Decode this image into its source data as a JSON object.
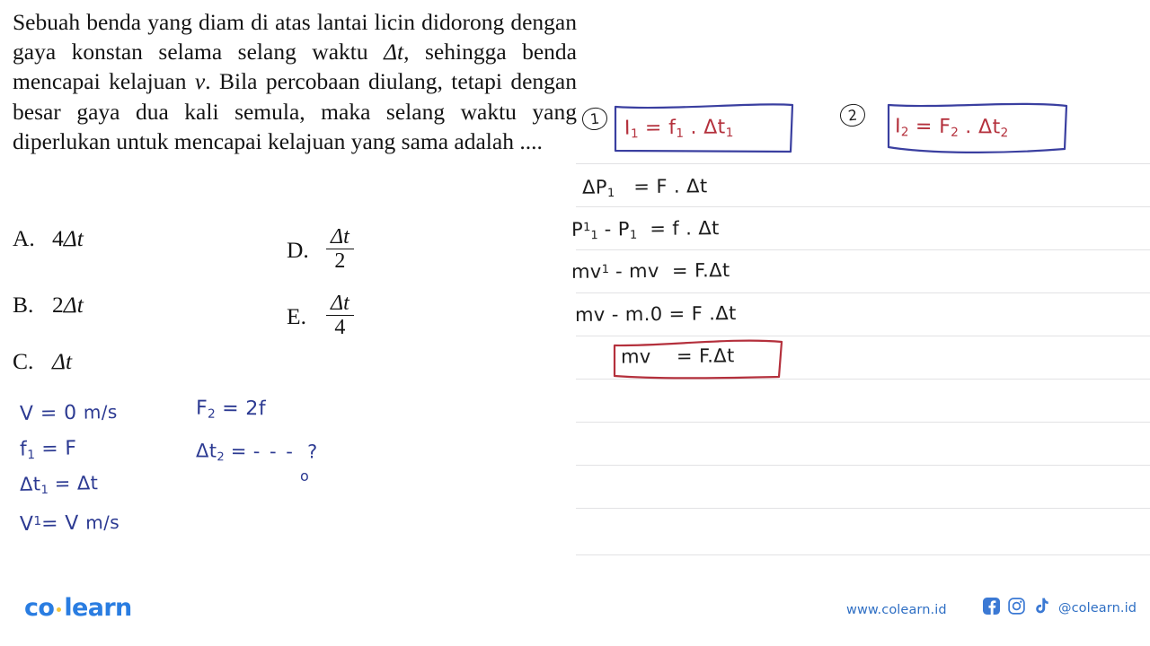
{
  "question": {
    "text_html": "Sebuah benda yang diam di atas lantai licin didorong dengan gaya konstan selama selang waktu <i>&#916;t</i>, sehingga benda mencapai kelajuan <i>v</i>. Bila percobaan diulang, tetapi dengan besar gaya dua kali semula, maka selang waktu yang diperlukan untuk mencapai kelajuan yang sama adalah ...."
  },
  "options": [
    {
      "letter": "A.",
      "value": "4Δt"
    },
    {
      "letter": "B.",
      "value": "2Δt"
    },
    {
      "letter": "C.",
      "value": "Δt"
    },
    {
      "letter": "D.",
      "value": "Δt / 2",
      "numerator": "Δt",
      "denominator": "2"
    },
    {
      "letter": "E.",
      "value": "Δt / 4",
      "numerator": "Δt",
      "denominator": "4"
    }
  ],
  "handwriting": {
    "left_notes": [
      "V = 0 m/s",
      "f₁ = F",
      "Δt₁ = Δt",
      "V' = V m/s"
    ],
    "mid_notes": [
      "F₂ = 2f",
      "Δt₂ = --- ?"
    ],
    "step_markers": [
      "1",
      "2"
    ],
    "boxed_formula_1": "I₁ = f₁ . Δt₁",
    "boxed_formula_2": "I₂ = F₂ . Δt₂",
    "derivation": [
      "ΔP₁   = F . Δt",
      "P'₁ - P₁  = f . Δt",
      "mv' - mv  = F.Δt",
      "mv - m.0 = F .Δt"
    ],
    "boxed_result": "mv    = F.Δt"
  },
  "ruled_lines": {
    "y_positions": [
      182,
      230,
      278,
      326,
      374,
      422,
      470,
      518,
      566,
      618
    ],
    "color": "#e2e2e4"
  },
  "footer": {
    "logo_first": "co",
    "logo_second": "learn",
    "website": "www.colearn.id",
    "handle": "@colearn.id",
    "icons": [
      "facebook-icon",
      "instagram-icon",
      "tiktok-icon"
    ]
  },
  "colors": {
    "ink_blue": "#2c3a92",
    "ink_red": "#b4303c",
    "ink_black": "#1b1b1b",
    "brand_blue": "#2a7de1",
    "brand_yellow": "#f5c53b",
    "link_blue": "#2f6fc4"
  }
}
